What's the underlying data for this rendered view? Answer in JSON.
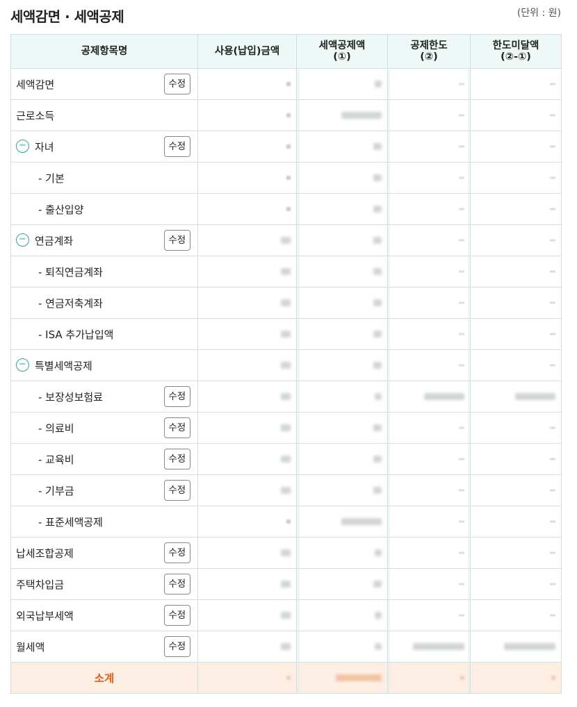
{
  "title": "세액감면 · 세액공제",
  "unit_note": "(단위 : 원)",
  "edit_label": "수정",
  "toggle_symbol": "−",
  "columns": {
    "item": "공제항목명",
    "used": "사용(납입)금액",
    "credit": "세액공제액\n(①)",
    "limit": "공제한도\n(②)",
    "remaining": "한도미달액\n(②-①)"
  },
  "rows": [
    {
      "label": "세액감면",
      "indent": false,
      "toggle": false,
      "edit": true
    },
    {
      "label": "근로소득",
      "indent": false,
      "toggle": false,
      "edit": false
    },
    {
      "label": "자녀",
      "indent": false,
      "toggle": true,
      "edit": true
    },
    {
      "label": "- 기본",
      "indent": true,
      "toggle": false,
      "edit": false
    },
    {
      "label": "- 출산입양",
      "indent": true,
      "toggle": false,
      "edit": false
    },
    {
      "label": "연금계좌",
      "indent": false,
      "toggle": true,
      "edit": true
    },
    {
      "label": "- 퇴직연금계좌",
      "indent": true,
      "toggle": false,
      "edit": false
    },
    {
      "label": "- 연금저축계좌",
      "indent": true,
      "toggle": false,
      "edit": false
    },
    {
      "label": "- ISA 추가납입액",
      "indent": true,
      "toggle": false,
      "edit": false
    },
    {
      "label": "특별세액공제",
      "indent": false,
      "toggle": true,
      "edit": false
    },
    {
      "label": "- 보장성보험료",
      "indent": true,
      "toggle": false,
      "edit": true
    },
    {
      "label": "- 의료비",
      "indent": true,
      "toggle": false,
      "edit": true
    },
    {
      "label": "- 교육비",
      "indent": true,
      "toggle": false,
      "edit": true
    },
    {
      "label": "- 기부금",
      "indent": true,
      "toggle": false,
      "edit": true
    },
    {
      "label": "- 표준세액공제",
      "indent": true,
      "toggle": false,
      "edit": false
    },
    {
      "label": "납세조합공제",
      "indent": false,
      "toggle": false,
      "edit": true
    },
    {
      "label": "주택차입금",
      "indent": false,
      "toggle": false,
      "edit": true
    },
    {
      "label": "외국납부세액",
      "indent": false,
      "toggle": false,
      "edit": true
    },
    {
      "label": "월세액",
      "indent": false,
      "toggle": false,
      "edit": true
    }
  ],
  "subtotal_label": "소계",
  "colors": {
    "accent": "#2ba59a",
    "header_bg": "#eef8f6",
    "subtotal_bg": "#fdeee3",
    "subtotal_text": "#e0601a"
  }
}
